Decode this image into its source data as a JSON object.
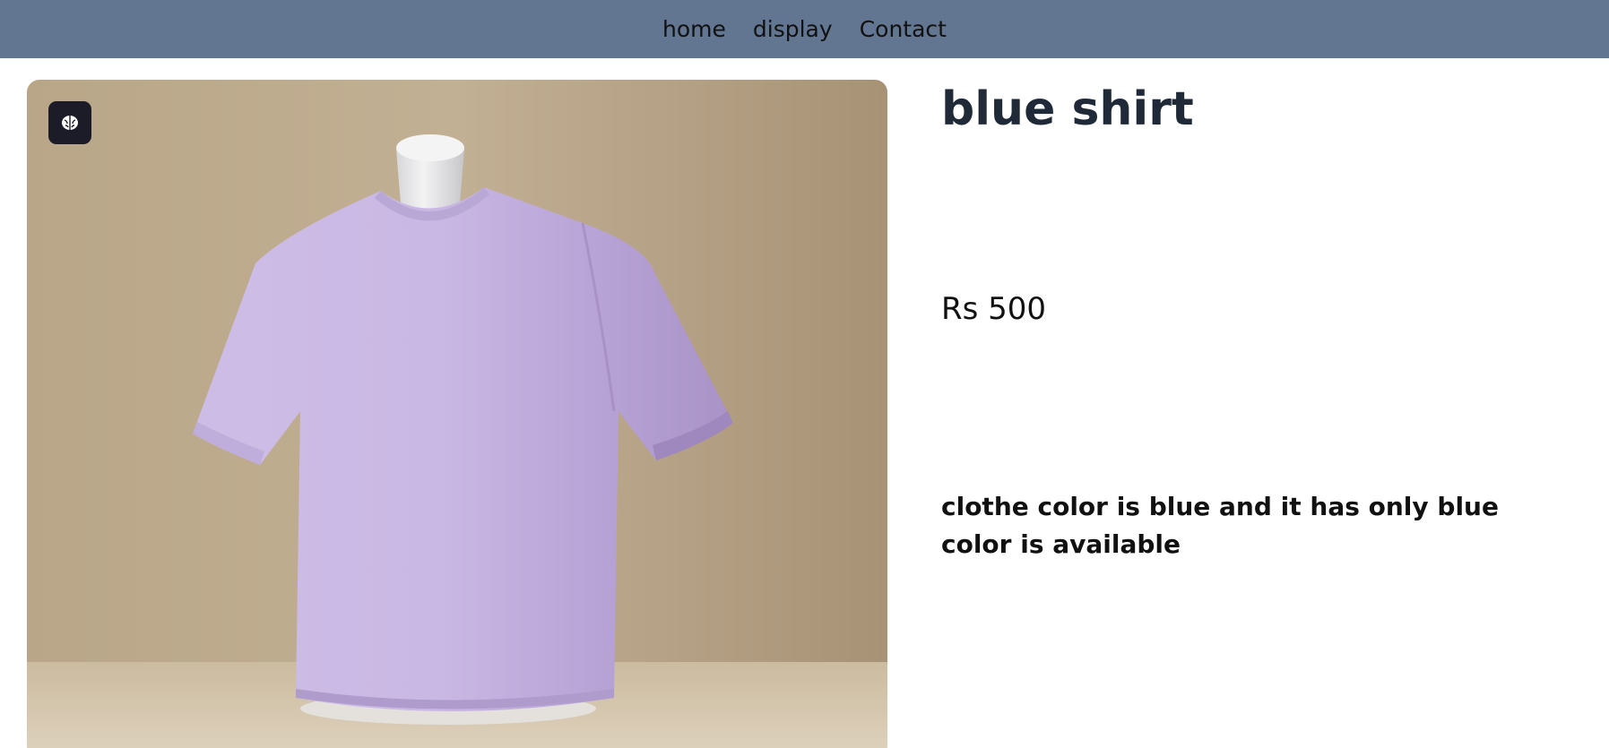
{
  "nav": {
    "items": [
      {
        "label": "home"
      },
      {
        "label": "display"
      },
      {
        "label": "Contact"
      }
    ]
  },
  "product": {
    "title": "blue shirt",
    "price": "Rs 500",
    "description": "clothe color is blue and it has only blue color is available",
    "image": {
      "subject": "lavender t-shirt on mannequin",
      "badge_icon": "brain-icon"
    }
  },
  "colors": {
    "navbar": "#627591",
    "title": "#1f2937",
    "shirt": "#c6b3e2",
    "background": "#b9a68b"
  }
}
